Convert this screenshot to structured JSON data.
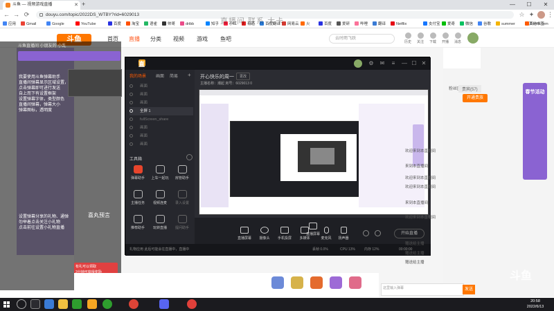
{
  "browser": {
    "tab_title": "斗鱼 — 视频游戏直播",
    "url": "douyu.com/topic/2022DS_WTBY?rid=6029013",
    "bookmarks": [
      "应用",
      "Gmail",
      "Google",
      "YouTube",
      "百度",
      "淘宝",
      "语雀",
      "帅哥",
      "dribb",
      "知乎",
      "小红",
      "有道",
      "百度翻译",
      "网易云",
      "火",
      "百度",
      "爱研",
      "哔哩",
      "翻译",
      "Netflix",
      "支付宝",
      "爱奇",
      "微信",
      "谷歌",
      "summer",
      "Fonts.com"
    ],
    "other_bookmarks": "其他书签"
  },
  "douyu": {
    "logo": "斗鱼",
    "nav": [
      "首页",
      "直播",
      "分类",
      "视频",
      "游戏",
      "鱼吧"
    ],
    "search_placeholder": "云时雨飞跃",
    "header_icons": [
      "历史",
      "关注",
      "下载",
      "开播",
      "消息",
      "创作中心"
    ],
    "float_title": "直播间 联系 大卡"
  },
  "left_panel": {
    "title": "斗鱼直播间 小朋友的 小乱",
    "lines": [
      "我要使用斗鱼弹幕助手",
      "直播间弹幕显示区域设置，",
      "点击弹幕即可进行发送",
      "自上而下有设置框架",
      "设置弹幕字体，类型颜色",
      "直播间弹幕，弹幕大小",
      "弹幕图标，透明度"
    ],
    "bottom_lines": [
      "设置弹幕分享的礼物、通弹",
      "勿举着点击关注小礼物",
      "点击前往设置小礼物直播"
    ],
    "promo": [
      "有礼可以领取",
      "3分钟可获得奖励"
    ],
    "anchor": "喜丸预言"
  },
  "app": {
    "name": "直播伴侣",
    "side_tabs": [
      "我的场景",
      "画面",
      "简易"
    ],
    "scenes": [
      "画面",
      "画面",
      "画面",
      "全屏 1",
      "fullScreen_share",
      "画面",
      "画面",
      "画面"
    ],
    "tools_title": "工具箱",
    "tools": [
      "弹幕助手",
      "上车一起玩",
      "房管助手",
      "主播任务",
      "视频连麦",
      "录入设置",
      "推荐助手",
      "玩转直播",
      "提问助手"
    ],
    "room_title": "开心快乐的周一",
    "room_tag": "更改",
    "room_info": "主播名称：潮起  房号：6029013  0",
    "controls": [
      "直播屏幕",
      "摄像头",
      "手机投屏",
      "多媒体",
      "麦克风",
      "扬声器"
    ],
    "start_button": "开始直播",
    "status": "礼物应用  此后可能会在直播中，直播中",
    "stats": [
      "丢帧 0.0%",
      "CPU 13%",
      "内存 12%",
      "00:00:00"
    ]
  },
  "right_col": {
    "tabs": [
      "粉丝团",
      "贵宾(57)"
    ],
    "follow_button": "开通贵族",
    "chat": [
      "欢迎来到本直播间",
      "来到本直播间",
      "欢迎来到本直播间",
      "欢迎来到本直播间",
      "来到本直播间",
      "欢迎来到本直播间",
      "赠送给主播",
      "赠送给主播",
      "赠送给主播"
    ],
    "input_placeholder": "这里输入弹幕",
    "send": "发送",
    "promo_title": "春节活动"
  },
  "taskbar": {
    "time": "20:58",
    "date": "2022/6/13"
  },
  "watermark": "斗鱼"
}
